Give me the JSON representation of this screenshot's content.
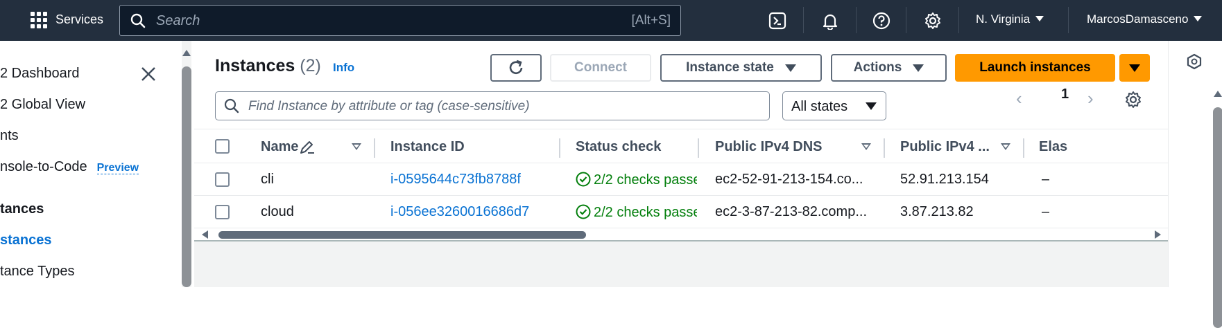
{
  "topnav": {
    "services_label": "Services",
    "search_placeholder": "Search",
    "search_shortcut": "[Alt+S]",
    "region": "N. Virginia",
    "user": "MarcosDamasceno"
  },
  "sidebar": {
    "items": [
      {
        "label": "2 Dashboard"
      },
      {
        "label": "2 Global View"
      },
      {
        "label": "nts"
      },
      {
        "label": "nsole-to-Code",
        "badge": "Preview"
      },
      {
        "label": "tances"
      },
      {
        "label": "stances"
      },
      {
        "label": "tance Types"
      }
    ]
  },
  "main": {
    "title": "Instances",
    "count": "(2)",
    "info": "Info",
    "connect": "Connect",
    "instance_state": "Instance state",
    "actions": "Actions",
    "launch": "Launch instances",
    "filter_placeholder": "Find Instance by attribute or tag (case-sensitive)",
    "states_select": "All states",
    "page": "1"
  },
  "table": {
    "columns": [
      "Name",
      "Instance ID",
      "Status check",
      "Public IPv4 DNS",
      "Public IPv4 ...",
      "Elas"
    ],
    "rows": [
      {
        "name": "cli",
        "id": "i-0595644c73fb8788f",
        "status": "2/2 checks passec",
        "dns": "ec2-52-91-213-154.co...",
        "ip": "52.91.213.154",
        "elastic": "–"
      },
      {
        "name": "cloud",
        "id": "i-056ee3260016686d7",
        "status": "2/2 checks passec",
        "dns": "ec2-3-87-213-82.comp...",
        "ip": "3.87.213.82",
        "elastic": "–"
      }
    ]
  },
  "colors": {
    "nav_bg": "#232f3e",
    "accent": "#ff9900",
    "link": "#0972d3",
    "success": "#037f0c"
  }
}
